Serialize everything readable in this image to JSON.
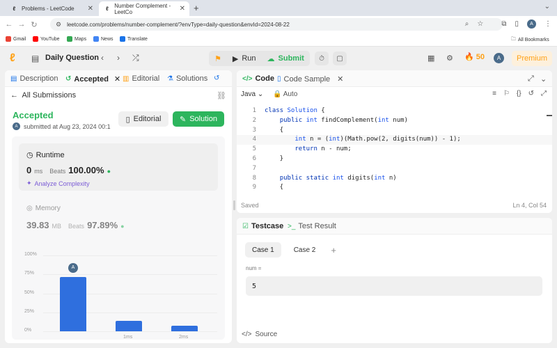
{
  "browser": {
    "tabs": [
      {
        "title": "Problems - LeetCode",
        "active": false
      },
      {
        "title": "Number Complement - LeetCo",
        "active": true
      }
    ],
    "url": "leetcode.com/problems/number-complement/?envType=daily-question&envId=2024-08-22",
    "bookmarks": [
      "Gmail",
      "YouTube",
      "Maps",
      "News",
      "Translate"
    ],
    "all_bookmarks": "All Bookmarks",
    "avatar_letter": "A"
  },
  "nav": {
    "title": "Daily Question",
    "run": "Run",
    "submit": "Submit",
    "streak": "50",
    "avatar_letter": "A",
    "premium": "Premium"
  },
  "left": {
    "tabs": [
      "Description",
      "Accepted",
      "Editorial",
      "Solutions"
    ],
    "back": "All Submissions",
    "status": "Accepted",
    "submitted": "submitted at Aug 23, 2024 00:1",
    "avatar_letter": "A",
    "editorial_btn": "Editorial",
    "solution_btn": "Solution",
    "runtime": {
      "label": "Runtime",
      "value": "0",
      "unit": "ms",
      "beats_label": "Beats",
      "beats": "100.00%"
    },
    "analyze": "Analyze Complexity",
    "memory": {
      "label": "Memory",
      "value": "39.83",
      "unit": "MB",
      "beats_label": "Beats",
      "beats": "97.89%"
    }
  },
  "chart_data": {
    "type": "bar",
    "ytick_labels": [
      "100%",
      "75%",
      "50%",
      "25%",
      "0%"
    ],
    "ylim": [
      0,
      100
    ],
    "x_labels": [
      "",
      "1ms",
      "2ms"
    ],
    "values": [
      72,
      14,
      7
    ],
    "highlight_index": 0,
    "highlight_label": "A",
    "color": "#2f6fde"
  },
  "code_panel": {
    "tabs": [
      "Code",
      "Code Sample"
    ],
    "language": "Java",
    "mode": "Auto",
    "lines": [
      "class Solution {",
      "    public int findComplement(int num)",
      "    {",
      "        int n = (int)(Math.pow(2, digits(num)) - 1);",
      "        return n - num;",
      "    }",
      "",
      "    public static int digits(int n)",
      "    {"
    ],
    "current_line": 4,
    "status": "Saved",
    "position": "Ln 4, Col 54"
  },
  "test_panel": {
    "tabs": [
      "Testcase",
      "Test Result"
    ],
    "cases": [
      "Case 1",
      "Case 2"
    ],
    "field_label": "num =",
    "field_value": "5",
    "source": "Source"
  }
}
